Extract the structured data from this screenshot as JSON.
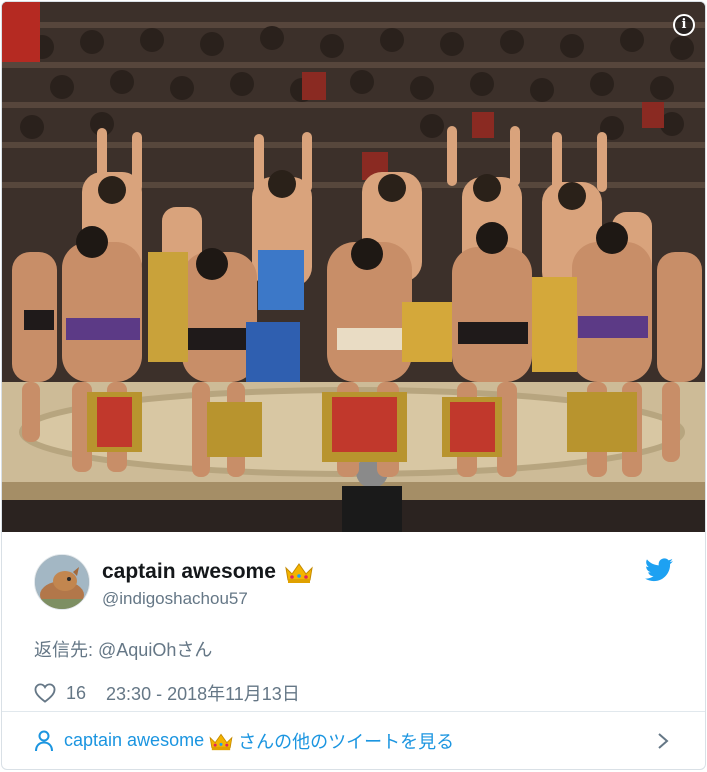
{
  "photo": {
    "alt_icon": "info-icon",
    "info_label": "i"
  },
  "tweet": {
    "display_name": "captain awesome",
    "name_emoji_icon": "crown-icon",
    "handle": "@indigoshachou57",
    "brand_icon": "twitter-bird-icon",
    "reply_prefix": "返信先: ",
    "reply_mention": "@AquiOh",
    "reply_suffix": "さん",
    "like_count": "16",
    "timestamp": "23:30 - 2018年11月13日",
    "colors": {
      "twitter_blue": "#1da1f2",
      "link_blue": "#1b95e0",
      "secondary_text": "#657786",
      "crown_gold": "#f4b400"
    }
  },
  "footer": {
    "prefix_name": "captain awesome",
    "suffix_text": "さんの他のツイートを見る",
    "person_icon": "person-icon",
    "chevron_icon": "chevron-right-icon"
  }
}
